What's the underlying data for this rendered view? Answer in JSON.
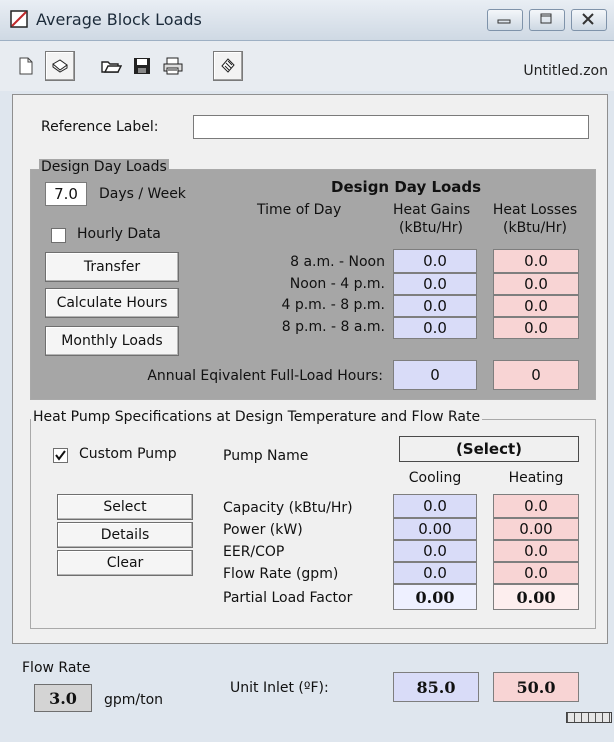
{
  "window": {
    "title": "Average Block Loads",
    "filename": "Untitled.zon"
  },
  "toolbar": {
    "buttons": [
      "new-file-icon",
      "open-file-icon",
      "open-folder-icon",
      "save-icon",
      "print-icon",
      "help-icon"
    ]
  },
  "reference": {
    "label": "Reference Label:",
    "value": ""
  },
  "design_day": {
    "group_title": "Design Day Loads",
    "days_value": "7.0",
    "days_label": "Days / Week",
    "hourly_label": "Hourly Data",
    "hourly_checked": false,
    "buttons": {
      "transfer": "Transfer",
      "calculate": "Calculate Hours",
      "monthly": "Monthly Loads"
    },
    "table_title": "Design Day Loads",
    "col_time": "Time of Day",
    "col_gains_1": "Heat Gains",
    "col_gains_2": "(kBtu/Hr)",
    "col_losses_1": "Heat Losses",
    "col_losses_2": "(kBtu/Hr)",
    "rows": [
      {
        "time": "8 a.m. - Noon",
        "gain": "0.0",
        "loss": "0.0"
      },
      {
        "time": "Noon - 4 p.m.",
        "gain": "0.0",
        "loss": "0.0"
      },
      {
        "time": "4 p.m. - 8 p.m.",
        "gain": "0.0",
        "loss": "0.0"
      },
      {
        "time": "8 p.m. - 8 a.m.",
        "gain": "0.0",
        "loss": "0.0"
      }
    ],
    "annual_label": "Annual Eqivalent Full-Load Hours:",
    "annual_gain": "0",
    "annual_loss": "0"
  },
  "heat_pump": {
    "group_title": "Heat Pump Specifications at Design Temperature and Flow Rate",
    "custom_label": "Custom Pump",
    "custom_checked": true,
    "pump_name_label": "Pump Name",
    "pump_select": "(Select)",
    "col_cooling": "Cooling",
    "col_heating": "Heating",
    "buttons": {
      "select": "Select",
      "details": "Details",
      "clear": "Clear"
    },
    "rows": [
      {
        "label": "Capacity (kBtu/Hr)",
        "cooling": "0.0",
        "heating": "0.0"
      },
      {
        "label": "Power (kW)",
        "cooling": "0.00",
        "heating": "0.00"
      },
      {
        "label": "EER/COP",
        "cooling": "0.0",
        "heating": "0.0"
      },
      {
        "label": "Flow Rate (gpm)",
        "cooling": "0.0",
        "heating": "0.0"
      }
    ],
    "plf_label": "Partial Load Factor",
    "plf_cooling": "0.00",
    "plf_heating": "0.00"
  },
  "footer": {
    "flow_rate_label": "Flow Rate",
    "flow_rate_value": "3.0",
    "flow_rate_unit": "gpm/ton",
    "unit_inlet_label": "Unit Inlet (ºF):",
    "inlet_cooling": "85.0",
    "inlet_heating": "50.0"
  },
  "colors": {
    "cooling_cell": "#d9dcf8",
    "heating_cell": "#f8d4d4",
    "panel": "#f0f0f0",
    "window_bg": "#dfe6ee"
  }
}
